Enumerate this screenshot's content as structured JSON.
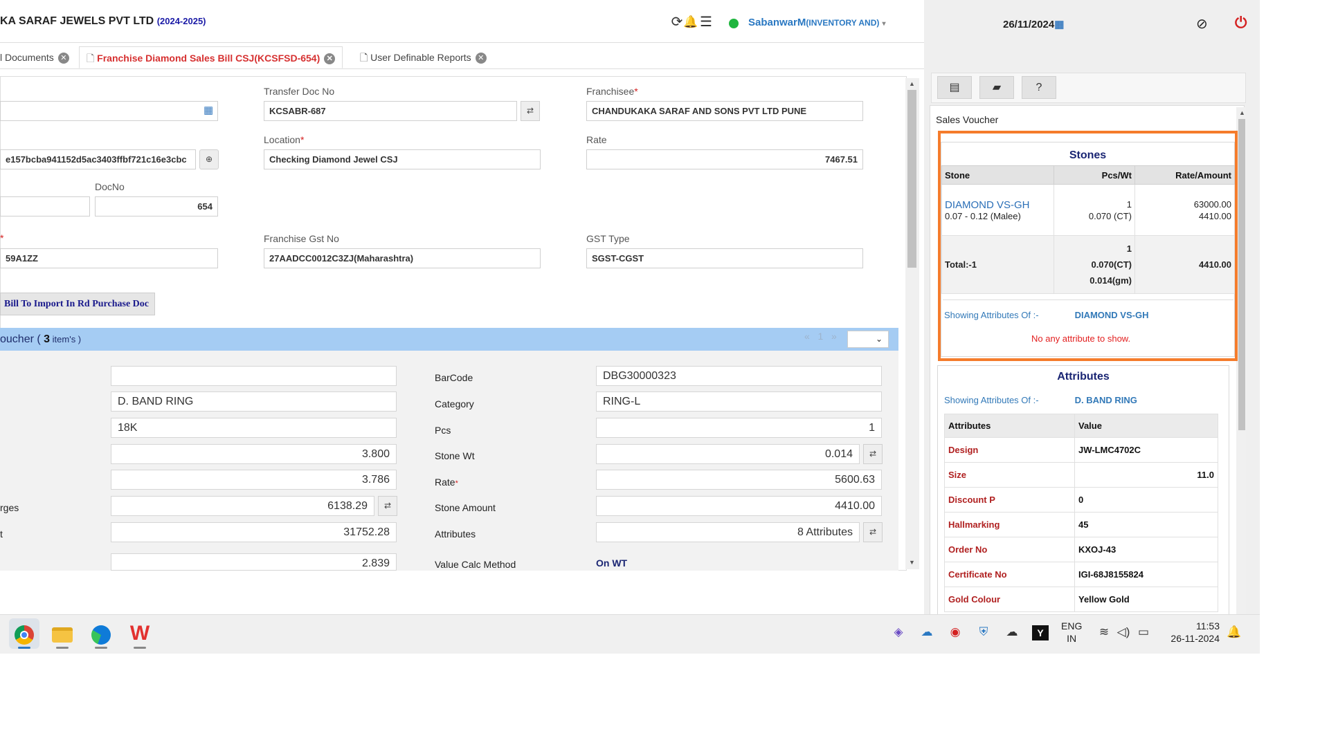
{
  "header": {
    "company": "KA SARAF JEWELS PVT LTD",
    "year": "(2024-2025)",
    "user": "SabanwarM",
    "role": "(INVENTORY AND)",
    "date": "26/11/2024",
    "icons": [
      "refresh-icon",
      "bell-icon",
      "list-icon",
      "eye-slash-icon",
      "power-icon",
      "calendar-icon"
    ]
  },
  "tabs": [
    {
      "label": "l Documents"
    },
    {
      "label": "Franchise Diamond Sales Bill CSJ(KCSFSD-654)"
    },
    {
      "label": "User Definable Reports"
    }
  ],
  "form": {
    "row1_hash": "e157bcba941152d5ac3403ffbf721c16e3cbc",
    "docno_label": "DocNo",
    "docno_value": "654",
    "gst_left_value": "59A1ZZ",
    "transfer_doc_label": "Transfer Doc No",
    "transfer_doc_value": "KCSABR-687",
    "location_label": "Location",
    "location_value": "Checking Diamond Jewel CSJ",
    "franchise_gst_label": "Franchise Gst No",
    "franchise_gst_value": "27AADCC0012C3ZJ(Maharashtra)",
    "franchisee_label": "Franchisee",
    "franchisee_value": "CHANDUKAKA SARAF AND SONS PVT LTD PUNE",
    "rate_label": "Rate",
    "rate_value": "7467.51",
    "gst_type_label": "GST Type",
    "gst_type_value": "SGST-CGST",
    "required_mark": "*",
    "import_button": "Bill To Import In Rd Purchase Doc"
  },
  "voucher": {
    "prefix": "oucher ( ",
    "count": "3",
    "suffix": " item's )",
    "page": "1",
    "pager_prev": "«",
    "pager_next": "»",
    "left_labels": [
      "rges",
      "t"
    ],
    "left_values": [
      "",
      "D. BAND RING",
      "18K",
      "3.800",
      "3.786",
      "6138.29",
      "31752.28",
      "2.839"
    ],
    "right_fields": [
      {
        "label": "BarCode",
        "value": "DBG30000323"
      },
      {
        "label": "Category",
        "value": "RING-L"
      },
      {
        "label": "Pcs",
        "value": "1"
      },
      {
        "label": "Stone Wt",
        "value": "0.014"
      },
      {
        "label": "Rate",
        "value": "5600.63"
      },
      {
        "label": "Stone Amount",
        "value": "4410.00"
      },
      {
        "label": "Attributes",
        "value": "8 Attributes"
      }
    ],
    "calc_label": "Value Calc Method",
    "calc_value": "On WT"
  },
  "sidebar": {
    "title": "Sales Voucher",
    "stones_header": "Stones",
    "cols": [
      "Stone",
      "Pcs/Wt",
      "Rate/Amount"
    ],
    "stone": {
      "name": "DIAMOND VS-GH",
      "size": "0.07 - 0.12 (Malee)",
      "pcs": "1",
      "wt": "0.070 (CT)",
      "rate": "63000.00",
      "amount": "4410.00"
    },
    "total": {
      "label": "Total:-1",
      "pcs": "1",
      "ct": "0.070(CT)",
      "gm": "0.014(gm)",
      "amount": "4410.00"
    },
    "showing_label": "Showing Attributes Of :-",
    "stone_attr_name": "DIAMOND VS-GH",
    "no_attr": "No any attribute to show.",
    "attributes_header": "Attributes",
    "item_attr_name": "D. BAND RING",
    "attr_cols": [
      "Attributes",
      "Value"
    ],
    "attributes": [
      {
        "k": "Design",
        "v": "JW-LMC4702C",
        "align": "left"
      },
      {
        "k": "Size",
        "v": "11.0",
        "align": "right"
      },
      {
        "k": "Discount P",
        "v": "0",
        "align": "left"
      },
      {
        "k": "Hallmarking",
        "v": "45",
        "align": "left"
      },
      {
        "k": "Order No",
        "v": "KXOJ-43",
        "align": "left"
      },
      {
        "k": "Certificate No",
        "v": "IGI-68J8155824",
        "align": "left"
      },
      {
        "k": "Gold Colour",
        "v": "Yellow Gold",
        "align": "left"
      }
    ]
  },
  "taskbar": {
    "lang1": "ENG",
    "lang2": "IN",
    "time": "11:53",
    "date": "26-11-2024"
  }
}
